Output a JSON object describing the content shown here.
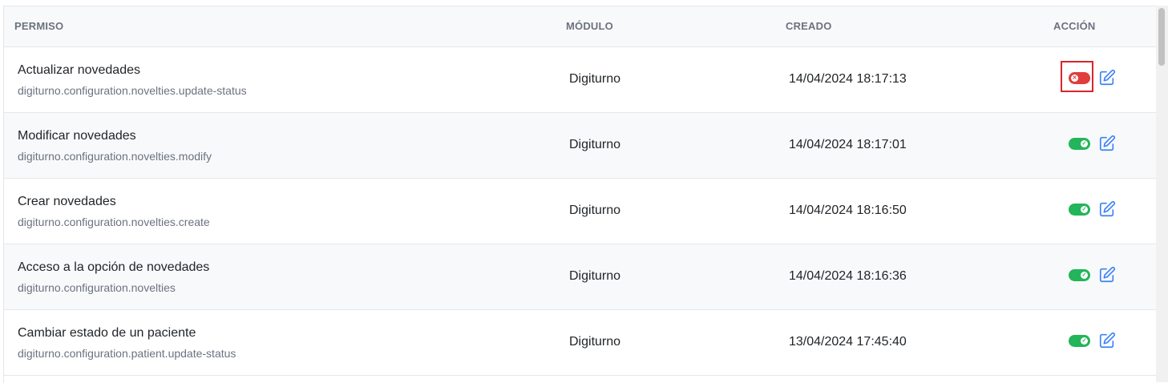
{
  "headers": {
    "permiso": "PERMISO",
    "modulo": "MÓDULO",
    "creado": "CREADO",
    "accion": "ACCIÓN"
  },
  "rows": [
    {
      "name": "Actualizar novedades",
      "key": "digiturno.configuration.novelties.update-status",
      "module": "Digiturno",
      "created": "14/04/2024 18:17:13",
      "enabled": false
    },
    {
      "name": "Modificar novedades",
      "key": "digiturno.configuration.novelties.modify",
      "module": "Digiturno",
      "created": "14/04/2024 18:17:01",
      "enabled": true
    },
    {
      "name": "Crear novedades",
      "key": "digiturno.configuration.novelties.create",
      "module": "Digiturno",
      "created": "14/04/2024 18:16:50",
      "enabled": true
    },
    {
      "name": "Acceso a la opción de novedades",
      "key": "digiturno.configuration.novelties",
      "module": "Digiturno",
      "created": "14/04/2024 18:16:36",
      "enabled": true
    },
    {
      "name": "Cambiar estado de un paciente",
      "key": "digiturno.configuration.patient.update-status",
      "module": "Digiturno",
      "created": "13/04/2024 17:45:40",
      "enabled": true
    }
  ],
  "icons": {
    "toggle_on": "toggle-on-icon",
    "toggle_off": "toggle-off-icon",
    "edit": "edit-icon"
  },
  "colors": {
    "toggle_on": "#22b55a",
    "toggle_off": "#e03d3d",
    "edit": "#3b82f6",
    "highlight": "#d9252a"
  }
}
